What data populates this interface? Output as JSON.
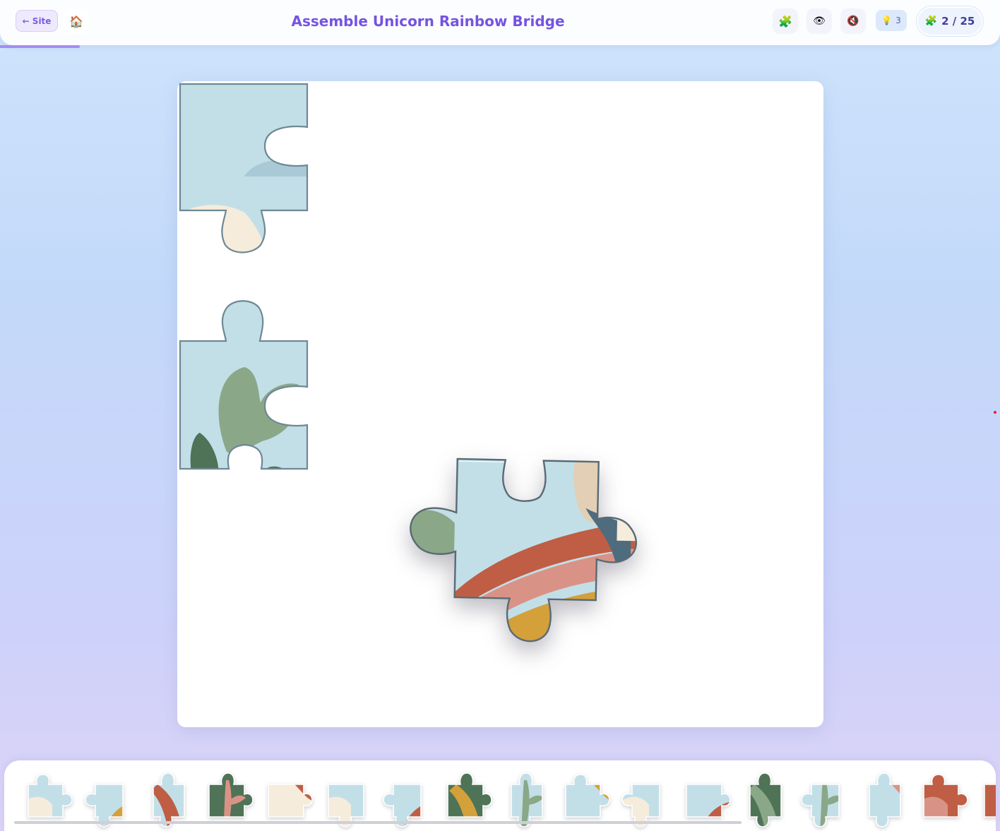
{
  "header": {
    "back_label": "← Site",
    "home_icon": "🏠",
    "title": "Assemble Unicorn Rainbow Bridge",
    "tools": [
      {
        "name": "puzzle-piece-icon",
        "glyph": "🧩"
      },
      {
        "name": "eye-icon",
        "glyph": "👁"
      },
      {
        "name": "sound-off-icon",
        "glyph": "🔇"
      }
    ],
    "hint_icon": "💡",
    "hint_count": "3",
    "counter_icon": "🧩",
    "counter": "2 / 25",
    "progress": 0.08
  },
  "colors": {
    "sky": "#c2dfe8",
    "cloud": "#f5ecdc",
    "sage": "#8aa788",
    "dark_green": "#4f7356",
    "red_orange": "#bf5e45",
    "pink": "#d99386",
    "mustard": "#d3a03a",
    "tan": "#e2cfb5",
    "navy": "#4e6c7e",
    "accent": "#7553e3"
  },
  "tray": {
    "pieces": [
      {
        "bg": "sky",
        "accent": "cloud"
      },
      {
        "bg": "sky",
        "accent": "mustard"
      },
      {
        "bg": "sky",
        "accent": "red_orange"
      },
      {
        "bg": "dark_green",
        "accent": "pink"
      },
      {
        "bg": "cloud",
        "accent": "red_orange"
      },
      {
        "bg": "sky",
        "accent": "cloud"
      },
      {
        "bg": "sky",
        "accent": "red_orange"
      },
      {
        "bg": "dark_green",
        "accent": "mustard"
      },
      {
        "bg": "sky",
        "accent": "sage"
      },
      {
        "bg": "sky",
        "accent": "mustard"
      },
      {
        "bg": "sky",
        "accent": "cloud"
      },
      {
        "bg": "sky",
        "accent": "red_orange"
      },
      {
        "bg": "dark_green",
        "accent": "sage"
      },
      {
        "bg": "sky",
        "accent": "sage"
      },
      {
        "bg": "sky",
        "accent": "pink"
      },
      {
        "bg": "red_orange",
        "accent": "pink"
      },
      {
        "bg": "red_orange",
        "accent": "dark_green"
      }
    ]
  }
}
